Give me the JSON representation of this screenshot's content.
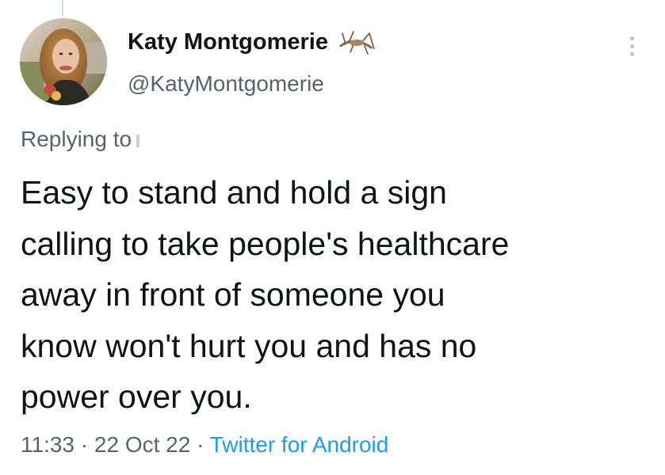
{
  "tweet": {
    "display_name": "Katy Montgomerie",
    "name_emoji": "cricket-emoji",
    "handle": "@KatyMontgomerie",
    "replying_to_label": "Replying to",
    "text": "Easy to stand and hold a sign\ncalling to take people's healthcare\naway in front of someone you\nknow won't hurt you and has no\npower over you.",
    "time": "11:33",
    "separator": " · ",
    "date": "22 Oct 22",
    "source": "Twitter for Android"
  },
  "colors": {
    "text_primary": "#0f1419",
    "text_secondary": "#536471",
    "link": "#1d9bf0",
    "background": "#ffffff"
  },
  "icons": {
    "more": "vertical-ellipsis-icon",
    "avatar": "profile-photo"
  }
}
